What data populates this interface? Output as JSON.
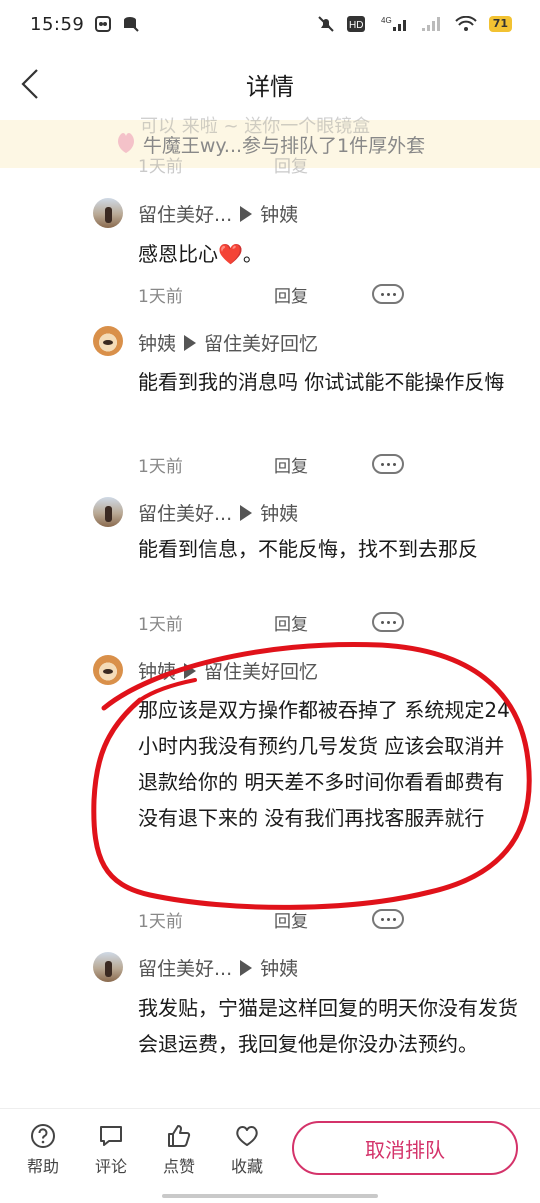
{
  "status": {
    "time": "15:59",
    "battery": "71",
    "signal_label": "4G",
    "hd_label": "HD"
  },
  "header": {
    "title": "详情"
  },
  "banner": {
    "text": "牛魔王wy...参与排队了1件厚外套",
    "ghost_text": "可以 来啦 ~ 送你一个眼镜盒",
    "ghost_time": "1天前",
    "ghost_reply": "回复"
  },
  "comments": [
    {
      "from": "留住美好...",
      "to": "钟姨",
      "text": "感恩比心❤️。",
      "time": "1天前",
      "reply": "回复"
    },
    {
      "from": "钟姨",
      "to": "留住美好回忆",
      "text": "能看到我的消息吗 你试试能不能操作反悔",
      "time": "1天前",
      "reply": "回复"
    },
    {
      "from": "留住美好...",
      "to": "钟姨",
      "text": "能看到信息，不能反悔，找不到去那反",
      "time": "1天前",
      "reply": "回复"
    },
    {
      "from": "钟姨",
      "to": "留住美好回忆",
      "text": "那应该是双方操作都被吞掉了 系统规定24小时内我没有预约几号发货 应该会取消并退款给你的 明天差不多时间你看看邮费有没有退下来的 没有我们再找客服弄就行",
      "time": "1天前",
      "reply": "回复"
    },
    {
      "from": "留住美好...",
      "to": "钟姨",
      "text": "我发贴，宁猫是这样回复的明天你没有发货会退运费，我回复他是你没办法预约。",
      "time": "",
      "reply": ""
    }
  ],
  "bottom_bar": {
    "help": "帮助",
    "comment": "评论",
    "like": "点赞",
    "favorite": "收藏",
    "cancel_queue": "取消排队"
  },
  "colors": {
    "accent": "#d4336a",
    "annotation": "#e0121a",
    "banner_bg": "#fdf6e2"
  }
}
